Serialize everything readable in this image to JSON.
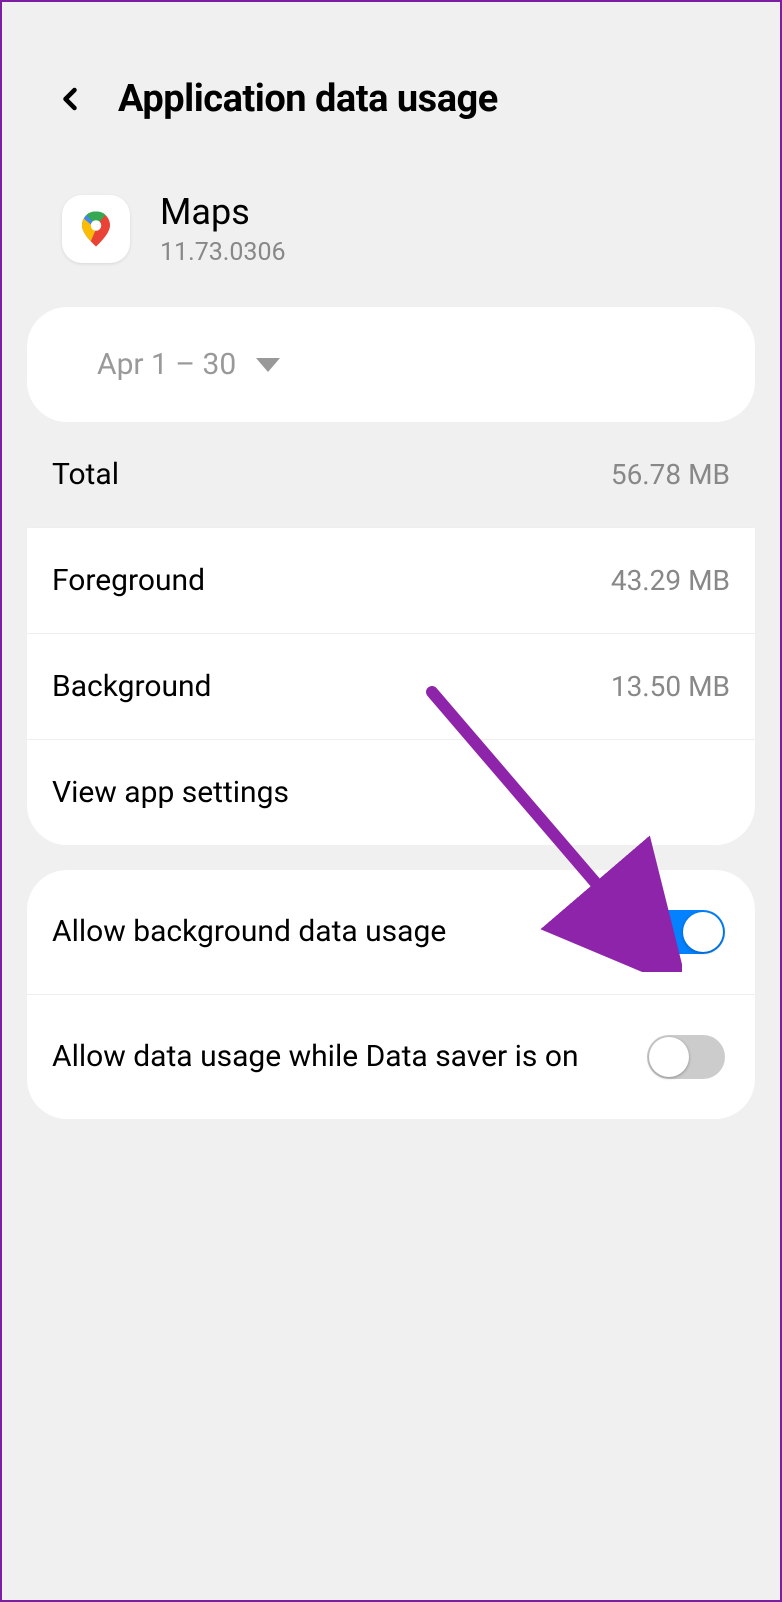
{
  "header": {
    "title": "Application data usage"
  },
  "app": {
    "name": "Maps",
    "version": "11.73.0306"
  },
  "dateRange": "Apr 1 – 30",
  "stats": {
    "total": {
      "label": "Total",
      "value": "56.78 MB"
    },
    "foreground": {
      "label": "Foreground",
      "value": "43.29 MB"
    },
    "background": {
      "label": "Background",
      "value": "13.50 MB"
    },
    "viewSettings": "View app settings"
  },
  "toggles": {
    "backgroundData": {
      "label": "Allow background data usage",
      "enabled": true
    },
    "dataSaver": {
      "label": "Allow data usage while Data saver is on",
      "enabled": false
    }
  }
}
